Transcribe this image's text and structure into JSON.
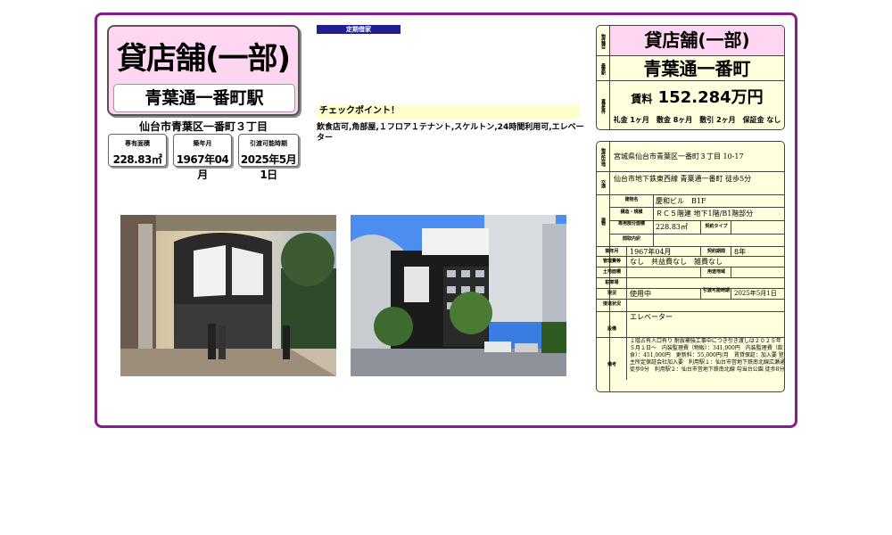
{
  "header": {
    "title": "貸店舗(一部)",
    "station": "青葉通一番町駅",
    "address": "仙台市青葉区一番町３丁目"
  },
  "stats": [
    {
      "label": "専有面積",
      "value": "228.83㎡"
    },
    {
      "label": "築年月",
      "value": "1967年04月"
    },
    {
      "label": "引渡可能時期",
      "value": "2025年5月1日"
    }
  ],
  "tag": "定期借家",
  "checkpoint": {
    "title": "チェックポイント！",
    "text": "飲食店可,角部屋,１フロア１テナント,スケルトン,24時間利用可,エレベーター"
  },
  "summary": {
    "type_label": "物件種目",
    "type": "貸店舗(一部)",
    "station_label": "最寄駅",
    "station": "青葉通一番町",
    "terms_label": "賃貸条件",
    "rent_label": "賃料",
    "rent": "152.284万円",
    "fees": "礼金 1ヶ月　敷金 8ヶ月　敷引 2ヶ月　保証金 なし"
  },
  "details": {
    "location_label": "物件所在地",
    "location": "宮城県仙台市青葉区一番町３丁目 10-17",
    "transport_label": "交通",
    "transport": "仙台市地下鉄東西線 青葉通一番町 徒歩5分",
    "building_label": "建物",
    "building_name_label": "建物名",
    "building_name": "慶和ビル　B1F",
    "structure_label": "構造・規模",
    "structure": "ＲＣ５階建 地下1階/B1階部分",
    "area_label": "専用部分面積",
    "area": "228.83㎡",
    "lease_type_label": "契約タイプ",
    "lease_type": "",
    "layout_label": "間取内訳",
    "layout": "",
    "built_label": "築年月",
    "built": "1967年04月",
    "term_label": "契約期間",
    "term": "8年",
    "mgmt_label": "管理費等",
    "mgmt": "なし　共益費なし　雑費なし",
    "landuse_label": "土地面積",
    "landuse": "",
    "zoning_label": "用途地域",
    "zoning": "",
    "parking_label": "駐車場",
    "parking": "",
    "status_label": "現況",
    "status": "使用中",
    "handover_label": "引渡可能時期",
    "handover": "2025年5月1日",
    "conn_label": "接道状況",
    "conn": "",
    "equip_label": "設備",
    "equip": "エレベーター",
    "remarks_label": "備考",
    "remarks": "１階占有人口有り 耐震補強工事中につき引き渡しは２０２５年５月１日〜　内装監理費（物販）：341,000円　内装監理費（飲食）：451,000円　更新料：55,000円/月　賃貸保証：加入要 登主所定保証会社加入要　利用駅１：仙台市営地下鉄南北線広瀬通 徒歩9分　利用駅２：仙台市営地下鉄南北線 勾当台公園 徒歩8分"
  },
  "colors": {
    "frame": "#8b1a8b",
    "title_bg": "#ffd6f2",
    "panel_bg": "#ffffde",
    "tag_bg": "#1f1f8f",
    "checkpoint_bg": "#ffffcc"
  }
}
